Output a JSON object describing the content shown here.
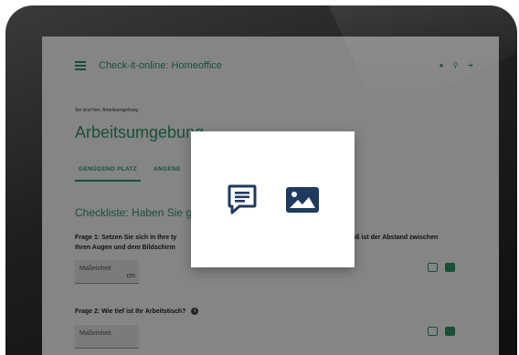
{
  "header": {
    "app_title": "Check-it-online: Homeoffice",
    "icons": [
      "menu-icon",
      "user-icon",
      "search-icon",
      "logout-icon"
    ]
  },
  "breadcrumb": "Sie sind hier: Arbeitsumgebung",
  "page_title": "Arbeitsumgebung",
  "tabs": [
    {
      "label": "GENÜGEND PLATZ",
      "active": true
    },
    {
      "label": "ANGENE"
    }
  ],
  "section_title": "Checkliste: Haben Sie g",
  "questions": [
    {
      "text_left": "Frage 1: Setzen Sie sich in Ihre ty",
      "text_left_line2": "Ihren Augen und dem Bildschirm",
      "text_right": "groß ist der Abstand zwischen",
      "input_placeholder": "Maßeinheit",
      "unit": "cm"
    },
    {
      "text_left": "Frage 2: Wie tief ist Ihr Arbeitstisch?",
      "info": "i",
      "input_placeholder": "Maßeinheit"
    }
  ],
  "dialog": {
    "icons": [
      "comment-icon",
      "image-icon"
    ]
  },
  "colors": {
    "accent": "#2f9a6a",
    "dialog_icon": "#1f3a5f",
    "overlay": "rgba(0,0,0,0.48)"
  }
}
